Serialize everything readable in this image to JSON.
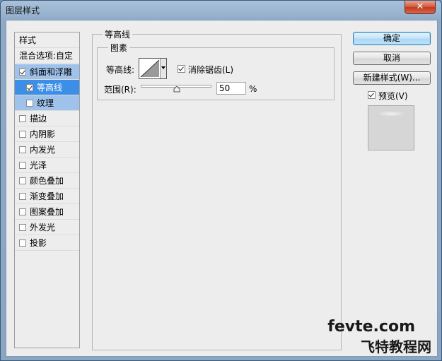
{
  "window": {
    "title": "图层样式",
    "close_glyph": "✕"
  },
  "style_list": {
    "header": "样式",
    "blend_options": "混合选项:自定",
    "items": [
      {
        "label": "斜面和浮雕",
        "checked": true
      },
      {
        "label": "等高线",
        "checked": true
      },
      {
        "label": "纹理",
        "checked": false
      },
      {
        "label": "描边",
        "checked": false
      },
      {
        "label": "内阴影",
        "checked": false
      },
      {
        "label": "内发光",
        "checked": false
      },
      {
        "label": "光泽",
        "checked": false
      },
      {
        "label": "颜色叠加",
        "checked": false
      },
      {
        "label": "渐变叠加",
        "checked": false
      },
      {
        "label": "图案叠加",
        "checked": false
      },
      {
        "label": "外发光",
        "checked": false
      },
      {
        "label": "投影",
        "checked": false
      }
    ]
  },
  "contour_panel": {
    "group_title": "等高线",
    "subgroup_title": "图素",
    "contour_label": "等高线:",
    "anti_alias_label": "消除锯齿(L)",
    "anti_alias_checked": true,
    "range_label": "范围(R):",
    "range_value": "50",
    "range_unit": "%",
    "range_fraction": 0.5
  },
  "buttons": {
    "ok": "确定",
    "cancel": "取消",
    "new_style": "新建样式(W)..."
  },
  "preview": {
    "label": "预览(V)",
    "checked": true
  },
  "watermark": {
    "line1": "fevte.com",
    "line2": "飞特教程网"
  },
  "colors": {
    "selected_blue": "#3d8ee6",
    "light_blue": "#9fc2ea",
    "dialog_bg": "#ededed"
  }
}
